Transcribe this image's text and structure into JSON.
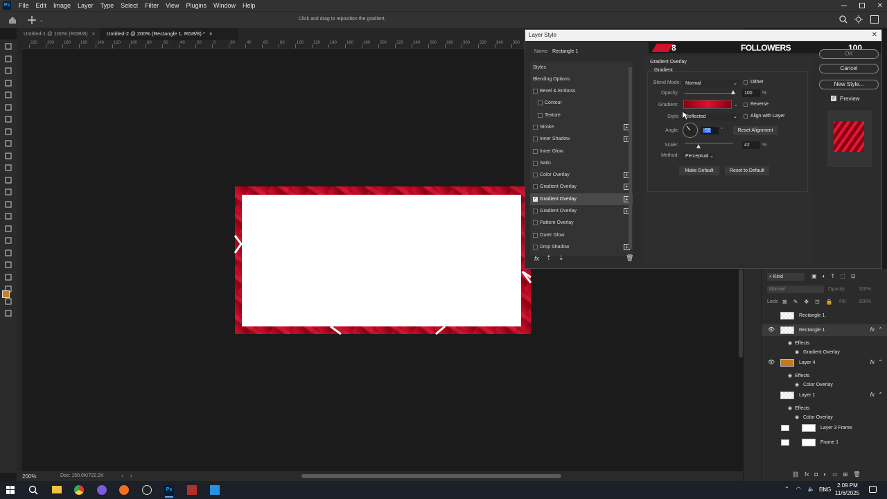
{
  "menubar": {
    "app_icon": "Ps",
    "items": [
      "File",
      "Edit",
      "Image",
      "Layer",
      "Type",
      "Select",
      "Filter",
      "View",
      "Plugins",
      "Window",
      "Help"
    ]
  },
  "options_bar": {
    "hint": "Click and drag to reposition the gradient."
  },
  "tabs": [
    {
      "label": "Untitled-1 @ 100% (RGB/8)"
    },
    {
      "label": "Untitled-2 @ 200% (Rectangle 1, RGB/8) *"
    }
  ],
  "ruler_labels": [
    "220",
    "200",
    "180",
    "160",
    "140",
    "120",
    "100",
    "80",
    "60",
    "40",
    "20",
    "0",
    "20",
    "40",
    "60",
    "80",
    "100",
    "120",
    "140",
    "160",
    "180",
    "200",
    "220",
    "240",
    "260",
    "280",
    "300",
    "320",
    "340",
    "360",
    "380"
  ],
  "status": {
    "zoom": "200%",
    "doc": "Doc: 150.0K/722.2K"
  },
  "dialog": {
    "title": "Layer Style",
    "name_label": "Name:",
    "name_value": "Rectangle 1",
    "banner": {
      "left_number": "8",
      "followers": "FOLLOWERS",
      "right_number": "100"
    },
    "buttons": {
      "ok": "OK",
      "cancel": "Cancel",
      "new_style": "New Style...",
      "preview": "Preview"
    },
    "styles_header": "Styles",
    "blending": "Blending Options",
    "styles": [
      {
        "label": "Bevel & Emboss",
        "checked": false,
        "plus": false,
        "indent": false
      },
      {
        "label": "Contour",
        "checked": false,
        "plus": false,
        "indent": true
      },
      {
        "label": "Texture",
        "checked": false,
        "plus": false,
        "indent": true
      },
      {
        "label": "Stroke",
        "checked": false,
        "plus": true,
        "indent": false
      },
      {
        "label": "Inner Shadow",
        "checked": false,
        "plus": true,
        "indent": false
      },
      {
        "label": "Inner Glow",
        "checked": false,
        "plus": false,
        "indent": false
      },
      {
        "label": "Satin",
        "checked": false,
        "plus": false,
        "indent": false
      },
      {
        "label": "Color Overlay",
        "checked": false,
        "plus": true,
        "indent": false
      },
      {
        "label": "Gradient Overlay",
        "checked": false,
        "plus": true,
        "indent": false
      },
      {
        "label": "Gradient Overlay",
        "checked": true,
        "plus": true,
        "indent": false,
        "selected": true
      },
      {
        "label": "Gradient Overlay",
        "checked": false,
        "plus": true,
        "indent": false
      },
      {
        "label": "Pattern Overlay",
        "checked": false,
        "plus": false,
        "indent": false
      },
      {
        "label": "Outer Glow",
        "checked": false,
        "plus": false,
        "indent": false
      },
      {
        "label": "Drop Shadow",
        "checked": false,
        "plus": true,
        "indent": false
      }
    ],
    "fx_label": "fx",
    "section_title": "Gradient Overlay",
    "subsection": "Gradient",
    "blend_mode_label": "Blend Mode:",
    "blend_mode": "Normal",
    "dither": "Dither",
    "opacity_label": "Opacity:",
    "opacity": "100",
    "opacity_percent": 100,
    "gradient_label": "Gradient:",
    "reverse": "Reverse",
    "style_label": "Style:",
    "style": "Reflected",
    "align": "Align with Layer",
    "angle_label": "Angle:",
    "angle": "-55",
    "reset_alignment": "Reset Alignment",
    "scale_label": "Scale:",
    "scale": "42",
    "scale_percent": 42,
    "percent": "%",
    "method_label": "Method:",
    "method": "Perceptual",
    "make_default": "Make Default",
    "reset_default": "Reset to Default",
    "colors": {
      "gradient_dark": "#8a0010",
      "gradient_light": "#e01030"
    }
  },
  "layers_panel": {
    "kind": "Kind",
    "blend": "Normal",
    "opacity_label": "Opacity:",
    "opacity": "100%",
    "lock_label": "Lock:",
    "fill_label": "Fill:",
    "fill": "100%",
    "rows": [
      {
        "name": "Rectangle 1",
        "type": "layer",
        "eye": false,
        "fx": false,
        "thumb": "checker"
      },
      {
        "name": "Rectangle 1",
        "type": "layer",
        "eye": true,
        "fx": true,
        "thumb": "checker",
        "selected": true
      },
      {
        "name": "Effects",
        "type": "effects"
      },
      {
        "name": "Gradient Overlay",
        "type": "effect"
      },
      {
        "name": "Layer 4",
        "type": "layer",
        "eye": true,
        "fx": true,
        "thumb": "orange"
      },
      {
        "name": "Effects",
        "type": "effects"
      },
      {
        "name": "Color Overlay",
        "type": "effect"
      },
      {
        "name": "Layer 1",
        "type": "layer",
        "eye": false,
        "fx": true,
        "thumb": "checker"
      },
      {
        "name": "Effects",
        "type": "effects"
      },
      {
        "name": "Color Overlay",
        "type": "effect"
      },
      {
        "name": "Layer 3 Frame",
        "type": "frame",
        "eye": false,
        "fx": false,
        "thumb": "frame"
      },
      {
        "name": "Frame 1",
        "type": "frame",
        "eye": false,
        "fx": false,
        "thumb": "white"
      }
    ]
  },
  "taskbar": {
    "time": "2:09 PM",
    "date": "11/6/2025",
    "lang": "ENG"
  }
}
